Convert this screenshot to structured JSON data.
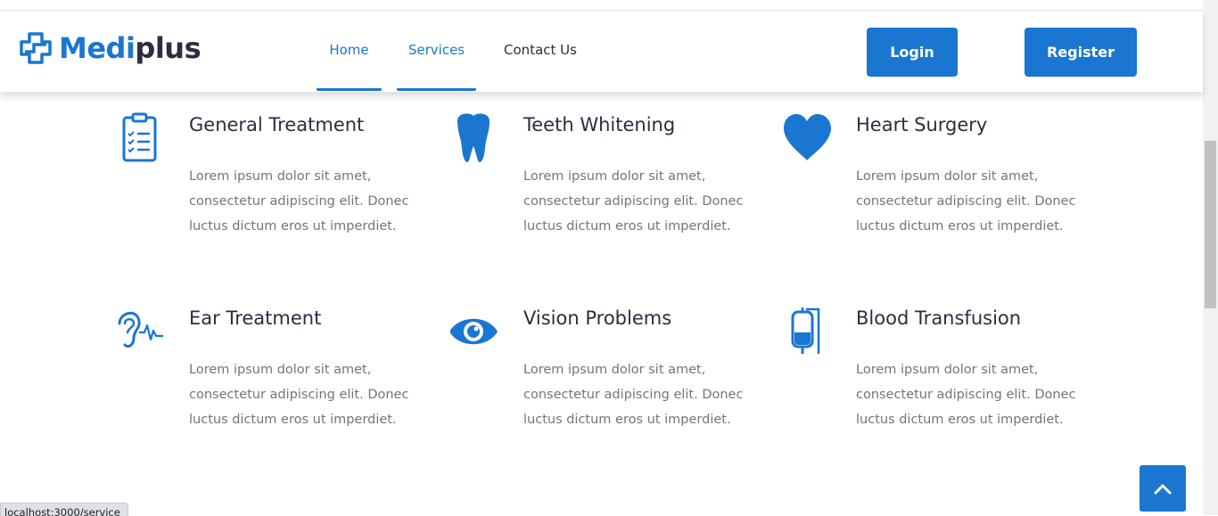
{
  "brand": {
    "name_part1": "Medi",
    "name_part2": "plus",
    "color": "#1a76d1",
    "dark": "#2c2d3f"
  },
  "nav": {
    "items": [
      {
        "label": "Home",
        "active": true
      },
      {
        "label": "Services",
        "active": true
      },
      {
        "label": "Contact Us",
        "active": false
      }
    ]
  },
  "auth": {
    "login_label": "Login",
    "register_label": "Register"
  },
  "services": [
    {
      "title": "General Treatment",
      "icon": "clipboard-icon",
      "text": "Lorem ipsum dolor sit amet, consectetur adipiscing elit. Donec luctus dictum eros ut imperdiet."
    },
    {
      "title": "Teeth Whitening",
      "icon": "tooth-icon",
      "text": "Lorem ipsum dolor sit amet, consectetur adipiscing elit. Donec luctus dictum eros ut imperdiet."
    },
    {
      "title": "Heart Surgery",
      "icon": "heart-icon",
      "text": "Lorem ipsum dolor sit amet, consectetur adipiscing elit. Donec luctus dictum eros ut imperdiet."
    },
    {
      "title": "Ear Treatment",
      "icon": "ear-icon",
      "text": "Lorem ipsum dolor sit amet, consectetur adipiscing elit. Donec luctus dictum eros ut imperdiet."
    },
    {
      "title": "Vision Problems",
      "icon": "eye-icon",
      "text": "Lorem ipsum dolor sit amet, consectetur adipiscing elit. Donec luctus dictum eros ut imperdiet."
    },
    {
      "title": "Blood Transfusion",
      "icon": "blood-bag-icon",
      "text": "Lorem ipsum dolor sit amet, consectetur adipiscing elit. Donec luctus dictum eros ut imperdiet."
    }
  ],
  "scroll_top": {
    "icon": "chevron-up-icon"
  },
  "status_bar": {
    "url": "localhost:3000/service"
  }
}
